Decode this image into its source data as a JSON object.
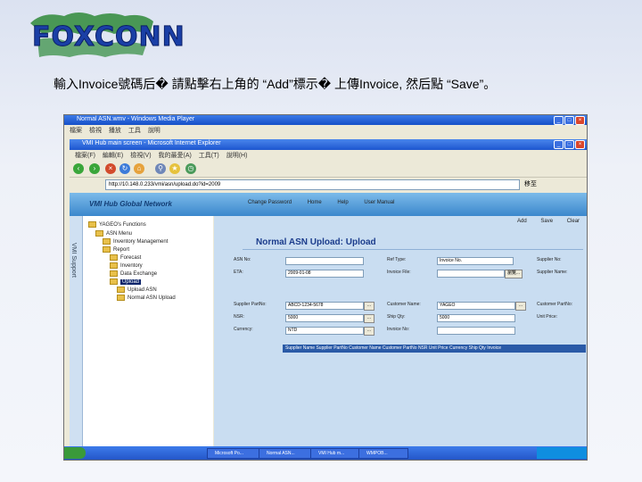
{
  "slide": {
    "logo_text": "FOXCONN",
    "instruction": "輸入Invoice號碼后� 請點擊右上角的 “Add”標示� 上傳Invoice, 然后點 “Save”。"
  },
  "screenshot": {
    "outer_window_title": "Normal ASN.wmv - Windows Media Player",
    "inner_window_title": "VMI Hub main screen - Microsoft Internet Explorer",
    "outer_menu": [
      "檔案",
      "檢視",
      "播放",
      "工具",
      "說明"
    ],
    "inner_menu": [
      "檔案(F)",
      "編輯(E)",
      "檢視(V)",
      "我的最愛(A)",
      "工具(T)",
      "說明(H)"
    ],
    "address_value": "http://10.148.0.233/vmi/asn/upload.do?id=2009",
    "go_label": "移至",
    "app_name": "VMI Hub Global Network",
    "app_nav": [
      "Change Password",
      "Home",
      "Help",
      "User Manual"
    ],
    "side_tab_label": "VMI Support",
    "tree": [
      {
        "label": "YAGEO's Functions"
      },
      {
        "label": "ASN Menu"
      },
      {
        "label": "Inventory Management"
      },
      {
        "label": "Report"
      },
      {
        "label": "Forecast"
      },
      {
        "label": "Inventory"
      },
      {
        "label": "Data Exchange"
      },
      {
        "label": "Upload",
        "selected": true
      },
      {
        "label": "Upload ASN"
      },
      {
        "label": "Normal ASN Upload"
      }
    ],
    "top_links": [
      "Add",
      "Save",
      "Clear"
    ],
    "form_title": "Normal ASN Upload: Upload",
    "fields": {
      "asn_no_label": "ASN No:",
      "asn_no_value": "",
      "eta_label": "ETA:",
      "eta_value": "2009-01-08",
      "supplier_partno_label": "Supplier PartNo:",
      "supplier_partno_value": "ABCD-1234-5678",
      "nsr_label": "NSR:",
      "nsr_value": "5000",
      "currency_label": "Currency:",
      "currency_value": "NTD",
      "ref_type_label": "Ref Type:",
      "ref_type_value": "Invoice No.",
      "invoice_file_label": "Invoice File:",
      "invoice_file_value": "",
      "browse_label": "瀏覽...",
      "customer_name_label": "Customer Name:",
      "customer_name_value": "YAGEO",
      "ship_qty_label": "Ship Qty:",
      "ship_qty_value": "5000",
      "invoice_no_label": "Invoice No:",
      "invoice_no_value": "",
      "supplier_no_label": "Supplier No:",
      "supplier_name_label": "Supplier Name:",
      "customer_partno_label": "Customer PartNo:",
      "unit_price_label": "Unit Price:"
    },
    "grid_header": "Supplier Name  Supplier PartNo  Customer Name  Customer PartNo  NSR  Unit Price  Currency  Ship Qty  Invoice",
    "taskbar_items": [
      "Microsoft Po...",
      "Normal ASN...",
      "VMI Hub m...",
      "WMPOB..."
    ]
  }
}
